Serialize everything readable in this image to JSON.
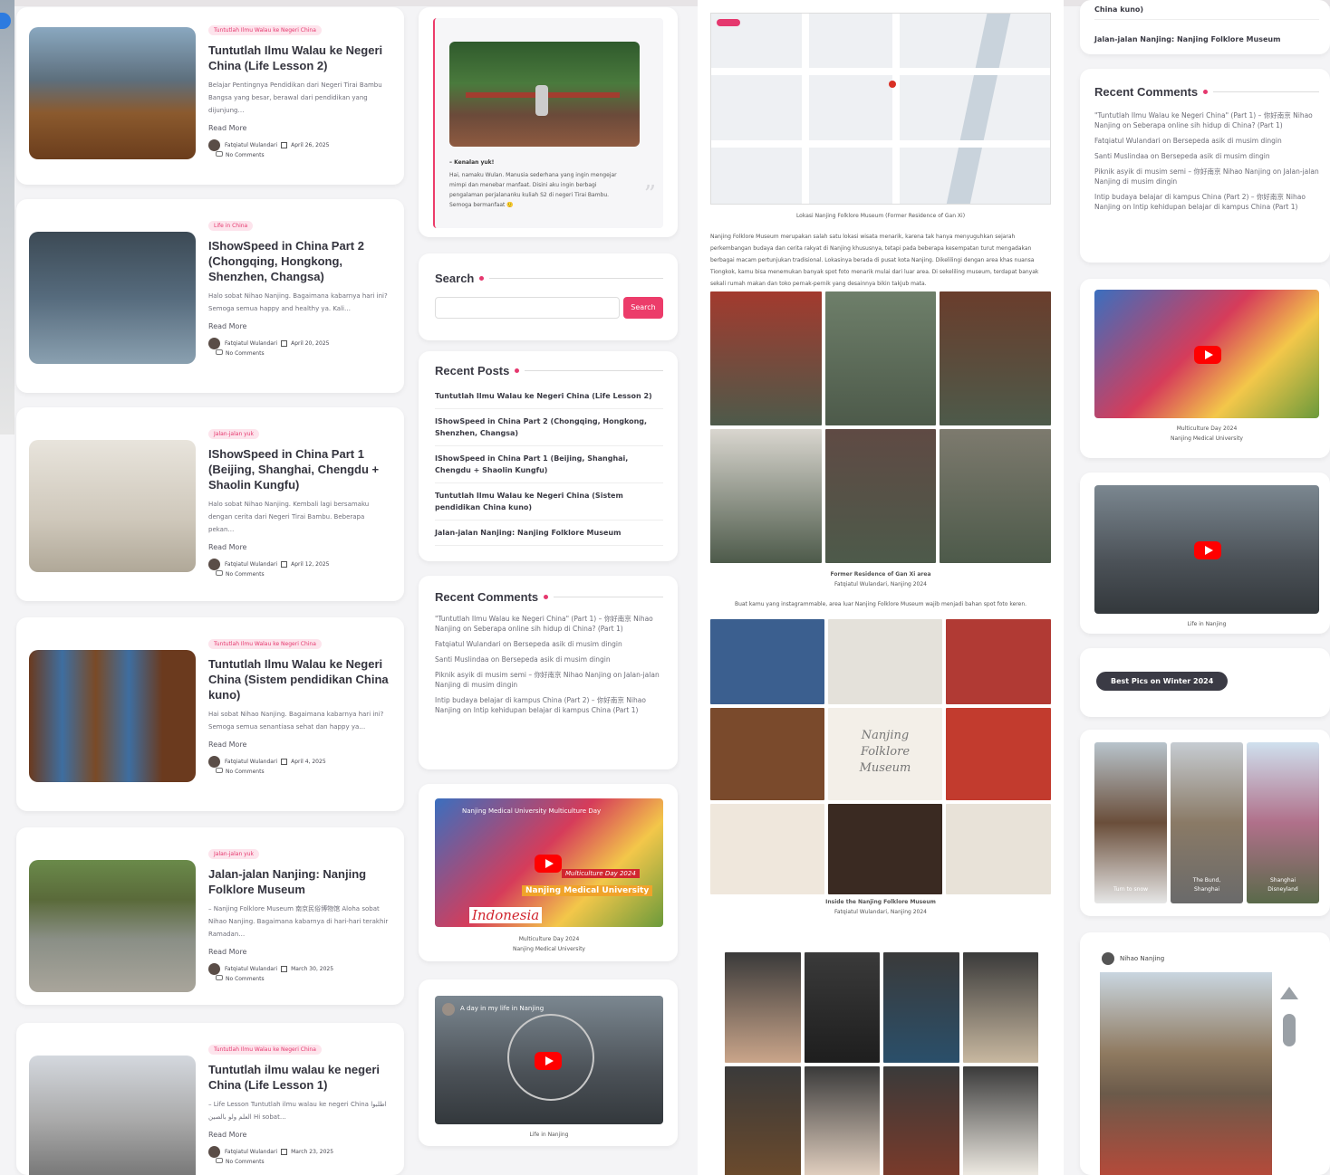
{
  "posts": [
    {
      "category": "Tuntutlah Ilmu Walau ke Negeri China",
      "title": "Tuntutlah Ilmu Walau ke Negeri China (Life Lesson 2)",
      "excerpt": "Belajar Pentingnya Pendidikan dari Negeri Tirai Bambu Bangsa yang besar, berawal dari pendidikan yang dijunjung…",
      "read_more": "Read More",
      "author": "Fatqiatul Wulandari",
      "date": "April 26, 2025",
      "comments": "No Comments"
    },
    {
      "category": "Life in China",
      "title": "IShowSpeed in China Part 2 (Chongqing, Hongkong, Shenzhen, Changsa)",
      "excerpt": "Halo sobat Nihao Nanjing. Bagaimana kabarnya hari ini? Semoga semua happy and healthy ya. Kali…",
      "read_more": "Read More",
      "author": "Fatqiatul Wulandari",
      "date": "April 20, 2025",
      "comments": "No Comments"
    },
    {
      "category": "Jalan-jalan yuk",
      "title": "IShowSpeed in China Part 1 (Beijing, Shanghai, Chengdu + Shaolin Kungfu)",
      "excerpt": "Halo sobat Nihao Nanjing. Kembali lagi bersamaku dengan cerita dari Negeri Tirai Bambu. Beberapa pekan…",
      "read_more": "Read More",
      "author": "Fatqiatul Wulandari",
      "date": "April 12, 2025",
      "comments": "No Comments"
    },
    {
      "category": "Tuntutlah Ilmu Walau ke Negeri China",
      "title": "Tuntutlah Ilmu Walau ke Negeri China (Sistem pendidikan China kuno)",
      "excerpt": "Hai sobat Nihao Nanjing. Bagaimana kabarnya hari ini? Semoga semua senantiasa sehat dan happy ya…",
      "read_more": "Read More",
      "author": "Fatqiatul Wulandari",
      "date": "April 4, 2025",
      "comments": "No Comments"
    },
    {
      "category": "Jalan-jalan yuk",
      "title": "Jalan-jalan Nanjing: Nanjing Folklore Museum",
      "excerpt": "– Nanjing Folklore Museum 南京民俗博物馆 Aloha sobat Nihao Nanjing. Bagaimana kabarnya di hari-hari terakhir Ramadan…",
      "read_more": "Read More",
      "author": "Fatqiatul Wulandari",
      "date": "March 30, 2025",
      "comments": "No Comments"
    },
    {
      "category": "Tuntutlah Ilmu Walau ke Negeri China",
      "title": "Tuntutlah ilmu walau ke negeri China (Life Lesson 1)",
      "excerpt": "– Life Lesson Tuntutlah ilmu walau ke negeri China اطلبوا العلم ولو بالصين Hi sobat…",
      "read_more": "Read More",
      "author": "Fatqiatul Wulandari",
      "date": "March 23, 2025",
      "comments": "No Comments"
    }
  ],
  "sidebar": {
    "quote": {
      "heading": "– Kenalan yuk!",
      "text": "Hai, namaku Wulan. Manusia sederhana yang ingin mengejar mimpi dan menebar manfaat. Disini aku ingin berbagi pengalaman perjalananku kuliah S2 di negeri Tirai Bambu. Semoga bermanfaat 🙂"
    },
    "search": {
      "title": "Search",
      "button": "Search",
      "placeholder": ""
    },
    "recent_posts": {
      "title": "Recent Posts",
      "items": [
        "Tuntutlah Ilmu Walau ke Negeri China (Life Lesson 2)",
        "IShowSpeed in China Part 2 (Chongqing, Hongkong, Shenzhen, Changsa)",
        "IShowSpeed in China Part 1 (Beijing, Shanghai, Chengdu + Shaolin Kungfu)",
        "Tuntutlah Ilmu Walau ke Negeri China (Sistem pendidikan China kuno)",
        "Jalan-jalan Nanjing: Nanjing Folklore Museum"
      ]
    },
    "recent_comments": {
      "title": "Recent Comments",
      "items": [
        "\"Tuntutlah Ilmu Walau ke Negeri China\" (Part 1) – 你好南京 Nihao Nanjing on Seberapa online sih hidup di China? (Part 1)",
        "Fatqiatul Wulandari on Bersepeda asik di musim dingin",
        "Santi Muslindaa on Bersepeda asik di musim dingin",
        "Piknik asyik di musim semi – 你好南京 Nihao Nanjing on Jalan-jalan Nanjing di musim dingin",
        "Intip budaya belajar di kampus China (Part 2) – 你好南京 Nihao Nanjing on Intip kehidupan belajar di kampus China (Part 1)"
      ]
    },
    "video1": {
      "title": "Nanjing Medical University Multiculture Day",
      "banner1": "Multiculture Day 2024",
      "banner2": "Nanjing Medical University",
      "brand": "Indonesia",
      "caption1": "Multiculture Day 2024",
      "caption2": "Nanjing Medical University"
    },
    "video2": {
      "title": "A day in my life in Nanjing",
      "caption": "Life in Nanjing"
    }
  },
  "article": {
    "map_caption": "Lokasi Nanjing Folklore Museum (Former Residence of Gan Xi)",
    "paragraph": "Nanjing Folklore Museum merupakan salah satu lokasi wisata menarik, karena tak hanya menyuguhkan sejarah perkembangan budaya dan cerita rakyat di Nanjing khususnya, tetapi pada beberapa kesempatan turut mengadakan berbagai macam pertunjukan tradisional. Lokasinya berada di pusat kota Nanjing. Dikelilingi dengan area khas nuansa Tiongkok, kamu bisa menemukan banyak spot foto menarik mulai dari luar area. Di sekeliling museum, terdapat banyak sekali rumah makan dan toko pernak-pernik yang desainnya bikin takjub mata.",
    "grid1_caption1": "Former Residence of Gan Xi area",
    "grid1_caption2": "Fatqiatul Wulandari, Nanjing 2024",
    "instagram_line": "Buat kamu yang instagrammable, area luar Nanjing Folklore Museum wajib menjadi bahan spot foto keren.",
    "grid2_caption1": "Inside the Nanjing Folklore Museum",
    "grid2_caption2": "Fatqiatul Wulandari, Nanjing 2024",
    "cursive": "Nanjing Folklore Museum"
  },
  "right": {
    "top_items": [
      "China kuno)",
      "Jalan-jalan Nanjing: Nanjing Folklore Museum"
    ],
    "recent_comments_title": "Recent Comments",
    "comments": [
      "\"Tuntutlah Ilmu Walau ke Negeri China\" (Part 1) – 你好南京 Nihao Nanjing on Seberapa online sih hidup di China? (Part 1)",
      "Fatqiatul Wulandari on Bersepeda asik di musim dingin",
      "Santi Muslindaa on Bersepeda asik di musim dingin",
      "Piknik asyik di musim semi – 你好南京 Nihao Nanjing on Jalan-jalan Nanjing di musim dingin",
      "Intip budaya belajar di kampus China (Part 2) – 你好南京 Nihao Nanjing on Intip kehidupan belajar di kampus China (Part 1)"
    ],
    "video1_caption1": "Multiculture Day 2024",
    "video1_caption2": "Nanjing Medical University",
    "video2_caption": "Life in Nanjing",
    "pill": "Best Pics on Winter 2024",
    "winter": [
      "Turn to snow",
      "The Bund, Shanghai",
      "Shanghai Disneyland"
    ],
    "ig_user": "Nihao Nanjing"
  },
  "colors": {
    "accent": "#ec3c6a",
    "dark": "#3b3b45"
  }
}
